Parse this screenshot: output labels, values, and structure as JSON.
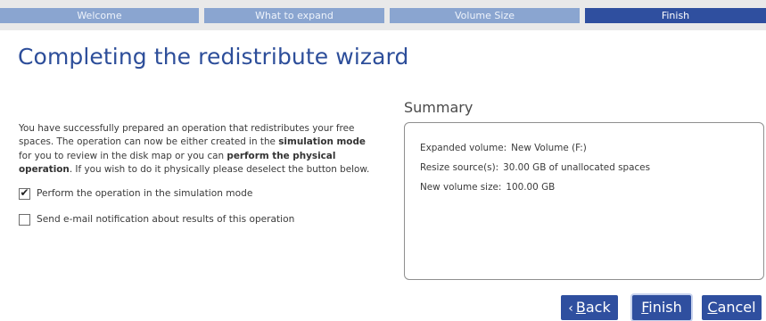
{
  "steps": [
    {
      "label": "Welcome",
      "active": false
    },
    {
      "label": "What to expand",
      "active": false
    },
    {
      "label": "Volume Size",
      "active": false
    },
    {
      "label": "Finish",
      "active": true
    }
  ],
  "page_title": "Completing the redistribute wizard",
  "description": {
    "part1": "You have successfully prepared an operation that redistributes your free spaces. The operation can now be either created in the ",
    "bold1": "simulation mode",
    "part2": " for you to review in the disk map or you can ",
    "bold2": "perform the physical operation",
    "part3": ". If you wish to do it physically please deselect the button below."
  },
  "options": {
    "simulation_label": "Perform the operation in the simulation mode",
    "simulation_checked": true,
    "email_label": "Send e-mail notification about results of this operation",
    "email_checked": false
  },
  "summary": {
    "title": "Summary",
    "rows": [
      {
        "key": "Expanded volume:",
        "value": "New Volume (F:)"
      },
      {
        "key": "Resize source(s):",
        "value": "30.00 GB of unallocated spaces"
      },
      {
        "key": "New volume size:",
        "value": "100.00 GB"
      }
    ]
  },
  "buttons": {
    "back_chevron": "‹",
    "back_mnemonic": "B",
    "back_rest": "ack",
    "finish_mnemonic": "F",
    "finish_rest": "inish",
    "cancel_mnemonic": "C",
    "cancel_rest": "ancel"
  },
  "colors": {
    "accent": "#2f4f9f",
    "step_inactive": "#8aa5d0",
    "title": "#2d4e9a"
  },
  "icons": {
    "checkbox_checked": "checkmark-icon",
    "back_arrow": "chevron-left-icon"
  }
}
